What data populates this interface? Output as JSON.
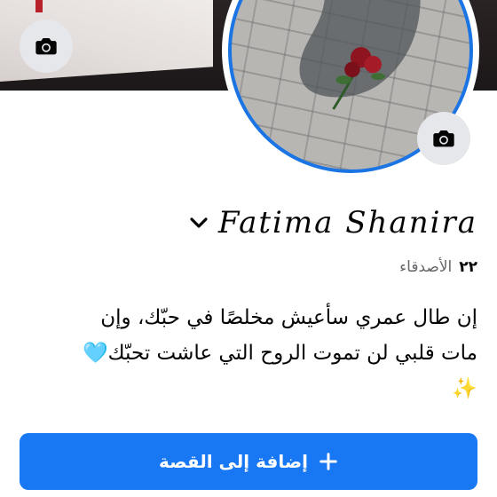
{
  "profile": {
    "name": "Fatima Shanira",
    "friends_count": "٢٢",
    "friends_label": "الأصدقاء",
    "bio_line1": "إن طال عمري سأعيش مخلصًا في حبّك، وإن",
    "bio_line2": "مات قلبي لن تموت الروح التي عاشت تحبّك🩵",
    "bio_line3": "✨"
  },
  "actions": {
    "add_story_label": "إضافة إلى القصة"
  },
  "icons": {
    "cover_camera": "camera-icon",
    "avatar_camera": "camera-icon",
    "name_menu": "chevron-down-icon",
    "add_story": "plus-icon"
  },
  "colors": {
    "accent": "#1877f2",
    "avatar_ring": "#1b74e4",
    "camera_button_bg": "#e6e7ea",
    "secondary_text": "#65676b"
  }
}
